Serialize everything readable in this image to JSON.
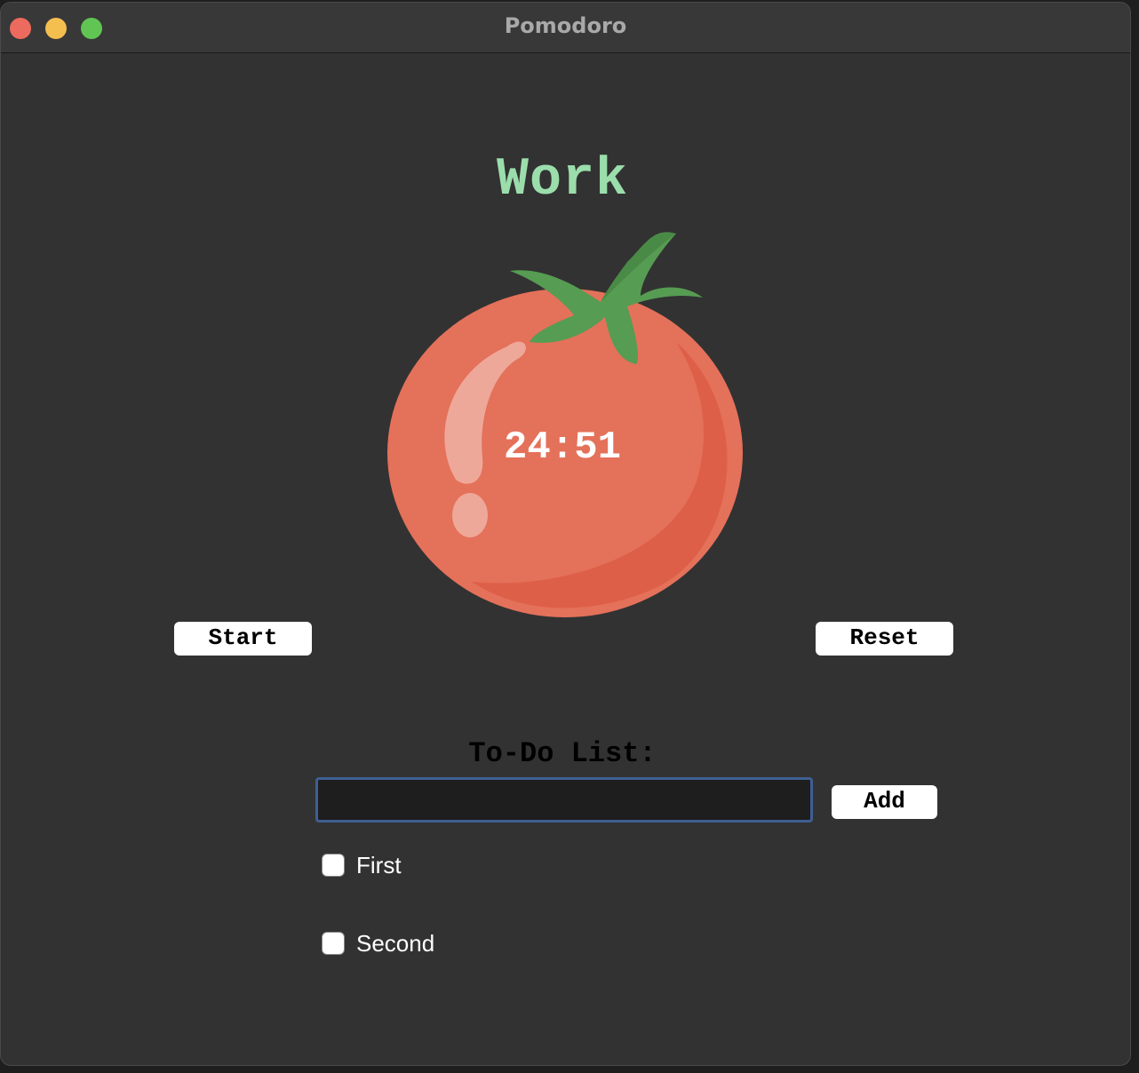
{
  "window": {
    "title": "Pomodoro"
  },
  "timer": {
    "mode_label": "Work",
    "time": "24:51"
  },
  "controls": {
    "start_label": "Start",
    "reset_label": "Reset"
  },
  "todo": {
    "heading": "To-Do List:",
    "input_value": "",
    "add_label": "Add",
    "items": [
      {
        "label": "First",
        "checked": false
      },
      {
        "label": "Second",
        "checked": false
      }
    ]
  },
  "colors": {
    "window_bg": "#323232",
    "work_label": "#9bdeac",
    "tomato_red": "#e4715a",
    "leaf_green": "#569c52",
    "input_border": "#3f5f92"
  },
  "icons": {
    "tomato": "tomato-icon"
  }
}
